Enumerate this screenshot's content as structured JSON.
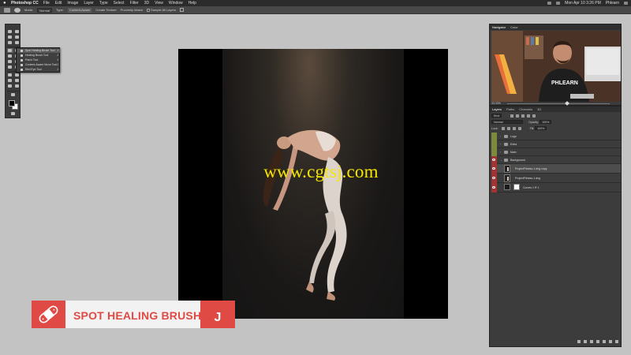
{
  "menubar": {
    "app": "Photoshop CC",
    "items": [
      "File",
      "Edit",
      "Image",
      "Layer",
      "Type",
      "Select",
      "Filter",
      "3D",
      "View",
      "Window",
      "Help"
    ],
    "clock": "Mon Apr 10  3:26 PM",
    "user": "Phlearn"
  },
  "options": {
    "mode_label": "Mode:",
    "mode_value": "Normal",
    "type_label": "Type:",
    "type_options": [
      "Content-Aware",
      "Create Texture",
      "Proximity Match"
    ],
    "type_selected": "Content-Aware",
    "sample_all_layers": "Sample All Layers"
  },
  "flyout": {
    "items": [
      {
        "label": "Spot Healing Brush Tool",
        "key": "J"
      },
      {
        "label": "Healing Brush Tool",
        "key": "J"
      },
      {
        "label": "Patch Tool",
        "key": "J"
      },
      {
        "label": "Content-Aware Move Tool",
        "key": "J"
      },
      {
        "label": "Red Eye Tool",
        "key": "J"
      }
    ]
  },
  "watermark": "www.cgtsj.com",
  "lower_third": {
    "title": "SPOT HEALING BRUSH",
    "shortcut": "J",
    "accent": "#e04a44"
  },
  "navigator": {
    "tabs": [
      "Navigator",
      "Color"
    ],
    "active_tab": "Navigator",
    "zoom": "33.33%",
    "logo_text": "PHLEARN"
  },
  "layers_panel": {
    "tabs": [
      "Layers",
      "Paths",
      "Channels",
      "3D"
    ],
    "active_tab": "Layers",
    "filter": "Kind",
    "blend_mode": "Normal",
    "opacity_label": "Opacity:",
    "opacity": "100%",
    "lock_label": "Lock:",
    "fill_label": "Fill:",
    "fill": "100%",
    "layers": [
      {
        "name": "Logo",
        "kind": "group",
        "color": "#7d8a3b",
        "visible": false
      },
      {
        "name": "Extra",
        "kind": "group",
        "color": "#7d8a3b",
        "visible": false
      },
      {
        "name": "Main",
        "kind": "group",
        "color": "#7d8a3b",
        "visible": false
      },
      {
        "name": "Background",
        "kind": "group",
        "color": "#a33232",
        "visible": true
      },
      {
        "name": "ProjectFitness-1.dng copy",
        "kind": "image",
        "color": "#a33232",
        "visible": true,
        "selected": true
      },
      {
        "name": "ProjectFitness-1.dng",
        "kind": "image",
        "color": "#a33232",
        "visible": true
      },
      {
        "name": "Curves 1 R 1",
        "kind": "adjustment",
        "color": "#a33232",
        "visible": true
      }
    ]
  }
}
